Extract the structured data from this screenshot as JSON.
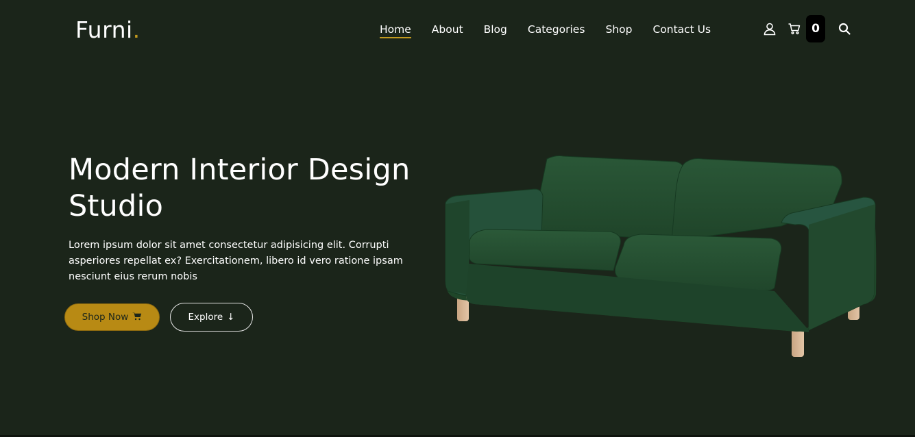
{
  "brand": {
    "name": "Furni",
    "dot": "."
  },
  "nav": {
    "items": [
      {
        "label": "Home",
        "active": true
      },
      {
        "label": "About",
        "active": false
      },
      {
        "label": "Blog",
        "active": false
      },
      {
        "label": "Categories",
        "active": false
      },
      {
        "label": "Shop",
        "active": false
      },
      {
        "label": "Contact Us",
        "active": false
      }
    ]
  },
  "header_icons": {
    "user": "user-icon",
    "cart": "cart-icon",
    "cart_count": "0",
    "search": "search-icon"
  },
  "hero": {
    "title": "Modern Interior Design Studio",
    "description": "Lorem ipsum dolor sit amet consectetur adipisicing elit. Corrupti asperiores repellat ex? Exercitationem, libero id vero ratione ipsam nesciunt eius rerum nobis",
    "shop_button": "Shop Now",
    "explore_button": "Explore",
    "explore_arrow": "↓"
  },
  "colors": {
    "background": "#1b251a",
    "accent": "#c29a1e",
    "button_primary": "#b88a14",
    "sofa": "#234a30"
  }
}
